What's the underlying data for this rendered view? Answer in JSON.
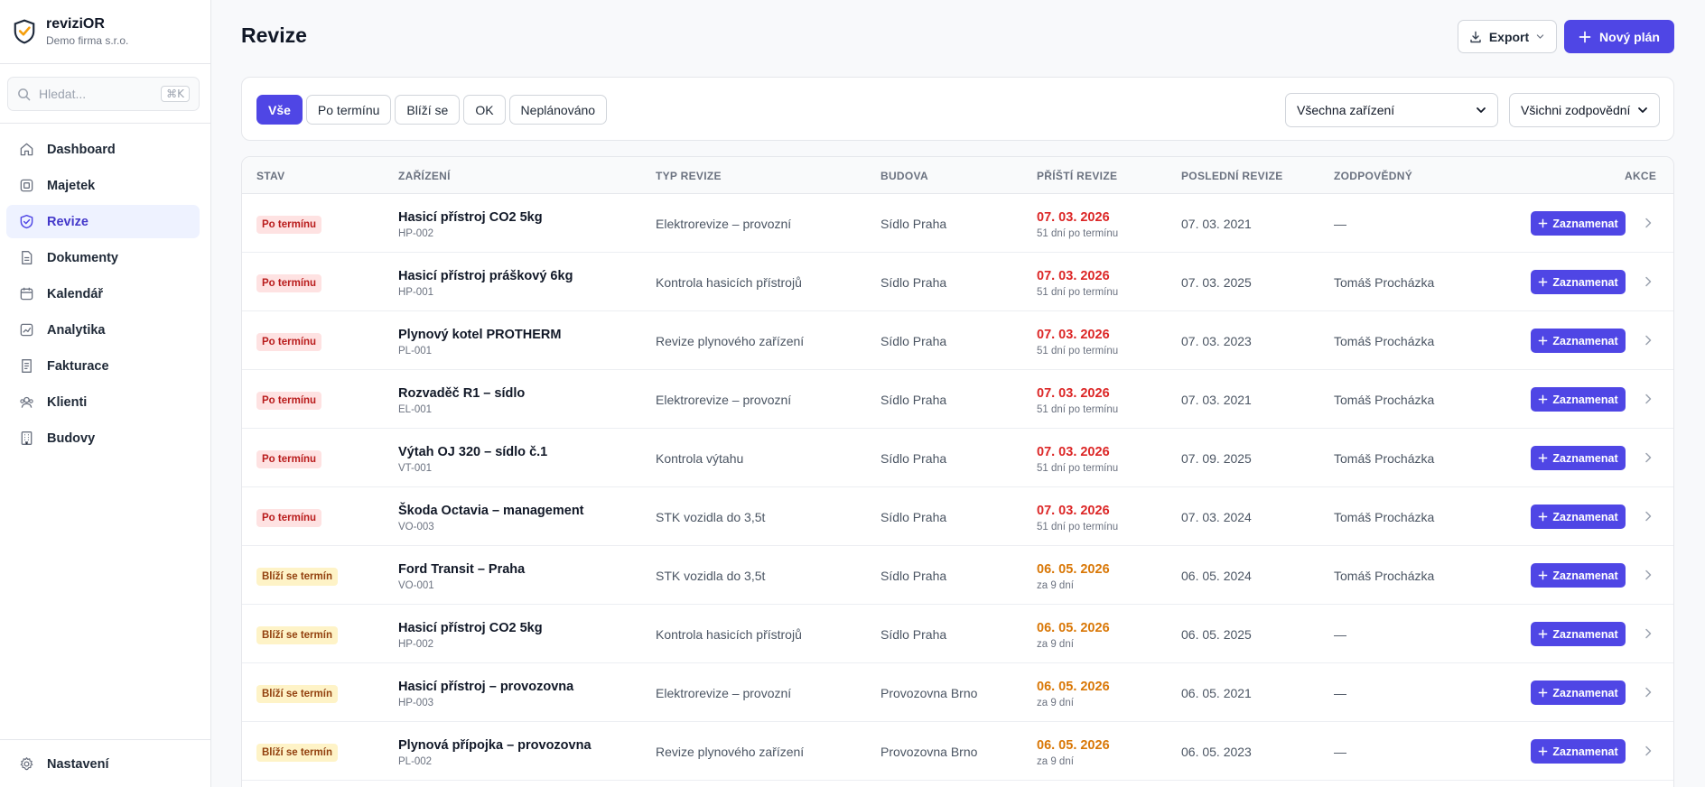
{
  "brand": {
    "name": "reviziOR",
    "company": "Demo firma s.r.o."
  },
  "search": {
    "placeholder": "Hledat...",
    "shortcut": "⌘K"
  },
  "nav": [
    {
      "label": "Dashboard",
      "icon": "home-icon"
    },
    {
      "label": "Majetek",
      "icon": "box-icon"
    },
    {
      "label": "Revize",
      "icon": "shield-check-icon",
      "active": true
    },
    {
      "label": "Dokumenty",
      "icon": "document-icon"
    },
    {
      "label": "Kalendář",
      "icon": "calendar-icon"
    },
    {
      "label": "Analytika",
      "icon": "chart-icon"
    },
    {
      "label": "Fakturace",
      "icon": "invoice-icon"
    },
    {
      "label": "Klienti",
      "icon": "users-icon"
    },
    {
      "label": "Budovy",
      "icon": "building-icon"
    }
  ],
  "settings": {
    "label": "Nastavení",
    "icon": "gear-icon"
  },
  "header": {
    "title": "Revize",
    "export_label": "Export",
    "new_label": "Nový plán"
  },
  "filters": {
    "chips": [
      {
        "label": "Vše",
        "active": true
      },
      {
        "label": "Po termínu"
      },
      {
        "label": "Blíží se"
      },
      {
        "label": "OK"
      },
      {
        "label": "Neplánováno"
      }
    ],
    "devices_select": "Všechna zařízení",
    "responsible_select": "Všichni zodpovědní"
  },
  "table": {
    "headers": {
      "status": "STAV",
      "device": "ZAŘÍZENÍ",
      "type": "TYP REVIZE",
      "building": "BUDOVA",
      "next": "PŘÍŠTÍ REVIZE",
      "last": "POSLEDNÍ REVIZE",
      "responsible": "ZODPOVĚDNÝ",
      "actions": "AKCE"
    },
    "record_label": "Zaznamenat",
    "rows": [
      {
        "status": "Po termínu",
        "kind": "over",
        "device": "Hasicí přístroj CO2 5kg",
        "code": "HP-002",
        "type": "Elektrorevize – provozní",
        "building": "Sídlo Praha",
        "next": "07. 03. 2026",
        "next_sub": "51 dní po termínu",
        "last": "07. 03. 2021",
        "responsible": "—"
      },
      {
        "status": "Po termínu",
        "kind": "over",
        "device": "Hasicí přístroj práškový 6kg",
        "code": "HP-001",
        "type": "Kontrola hasicích přístrojů",
        "building": "Sídlo Praha",
        "next": "07. 03. 2026",
        "next_sub": "51 dní po termínu",
        "last": "07. 03. 2025",
        "responsible": "Tomáš Procházka"
      },
      {
        "status": "Po termínu",
        "kind": "over",
        "device": "Plynový kotel PROTHERM",
        "code": "PL-001",
        "type": "Revize plynového zařízení",
        "building": "Sídlo Praha",
        "next": "07. 03. 2026",
        "next_sub": "51 dní po termínu",
        "last": "07. 03. 2023",
        "responsible": "Tomáš Procházka"
      },
      {
        "status": "Po termínu",
        "kind": "over",
        "device": "Rozvaděč R1 – sídlo",
        "code": "EL-001",
        "type": "Elektrorevize – provozní",
        "building": "Sídlo Praha",
        "next": "07. 03. 2026",
        "next_sub": "51 dní po termínu",
        "last": "07. 03. 2021",
        "responsible": "Tomáš Procházka"
      },
      {
        "status": "Po termínu",
        "kind": "over",
        "device": "Výtah OJ 320 – sídlo č.1",
        "code": "VT-001",
        "type": "Kontrola výtahu",
        "building": "Sídlo Praha",
        "next": "07. 03. 2026",
        "next_sub": "51 dní po termínu",
        "last": "07. 09. 2025",
        "responsible": "Tomáš Procházka"
      },
      {
        "status": "Po termínu",
        "kind": "over",
        "device": "Škoda Octavia – management",
        "code": "VO-003",
        "type": "STK vozidla do 3,5t",
        "building": "Sídlo Praha",
        "next": "07. 03. 2026",
        "next_sub": "51 dní po termínu",
        "last": "07. 03. 2024",
        "responsible": "Tomáš Procházka"
      },
      {
        "status": "Blíží se termín",
        "kind": "soon",
        "device": "Ford Transit – Praha",
        "code": "VO-001",
        "type": "STK vozidla do 3,5t",
        "building": "Sídlo Praha",
        "next": "06. 05. 2026",
        "next_sub": "za 9 dní",
        "last": "06. 05. 2024",
        "responsible": "Tomáš Procházka"
      },
      {
        "status": "Blíží se termín",
        "kind": "soon",
        "device": "Hasicí přístroj CO2 5kg",
        "code": "HP-002",
        "type": "Kontrola hasicích přístrojů",
        "building": "Sídlo Praha",
        "next": "06. 05. 2026",
        "next_sub": "za 9 dní",
        "last": "06. 05. 2025",
        "responsible": "—"
      },
      {
        "status": "Blíží se termín",
        "kind": "soon",
        "device": "Hasicí přístroj – provozovna",
        "code": "HP-003",
        "type": "Elektrorevize – provozní",
        "building": "Provozovna Brno",
        "next": "06. 05. 2026",
        "next_sub": "za 9 dní",
        "last": "06. 05. 2021",
        "responsible": "—"
      },
      {
        "status": "Blíží se termín",
        "kind": "soon",
        "device": "Plynová přípojka – provozovna",
        "code": "PL-002",
        "type": "Revize plynového zařízení",
        "building": "Provozovna Brno",
        "next": "06. 05. 2026",
        "next_sub": "za 9 dní",
        "last": "06. 05. 2023",
        "responsible": "—"
      }
    ]
  },
  "colors": {
    "accent": "#4f46e5",
    "overdue": "#dc2626",
    "soon": "#d97706"
  }
}
